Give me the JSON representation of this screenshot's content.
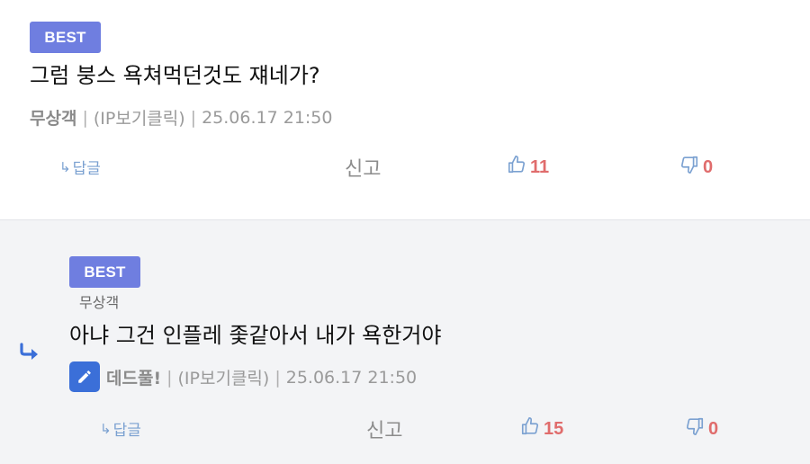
{
  "comments": [
    {
      "badge": "BEST",
      "text": "그럼 붕스 욕쳐먹던것도 쟤네가?",
      "nickname": "무상객",
      "separator": "|",
      "ip_label": "(IP보기클릭)",
      "timestamp": "25.06.17 21:50",
      "reply_label": "답글",
      "report_label": "신고",
      "likes": "11",
      "dislikes": "0"
    },
    {
      "badge": "BEST",
      "reply_to": "무상객",
      "text": "아냐 그건 인플레 좇같아서 내가 욕한거야",
      "nickname": "데드풀!",
      "separator": "|",
      "ip_label": "(IP보기클릭)",
      "timestamp": "25.06.17 21:50",
      "reply_label": "답글",
      "report_label": "신고",
      "likes": "15",
      "dislikes": "0"
    }
  ],
  "colors": {
    "badge": "#6f7ee0",
    "like_count": "#e06c6c",
    "thumb_icon": "#7ba1d1",
    "reply_arrow": "#3b6fd8"
  },
  "icons": [
    "reply-arrow-icon",
    "thumbs-up-icon",
    "thumbs-down-icon",
    "pencil-icon"
  ]
}
